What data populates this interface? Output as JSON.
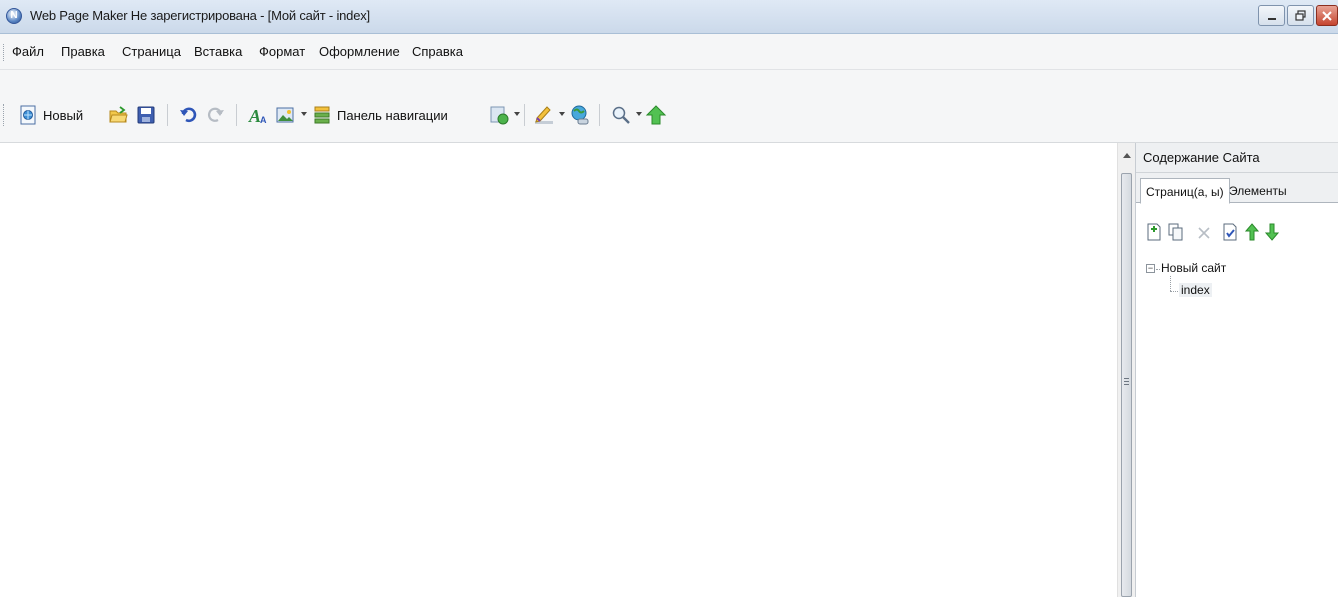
{
  "window": {
    "title": "Web Page Maker Не зарегистрирована - [Мой сайт - index]",
    "controls": [
      "minimize",
      "restore",
      "close"
    ]
  },
  "menu": {
    "items": [
      "Файл",
      "Правка",
      "Страница",
      "Вставка",
      "Формат",
      "Оформление",
      "Справка"
    ]
  },
  "toolbar": {
    "new_label": "Новый",
    "nav_panel_label": "Панель навигации",
    "icons": [
      "new-page-icon",
      "open-folder-icon",
      "save-icon",
      "undo-icon",
      "redo-icon",
      "text-style-icon",
      "image-icon",
      "navigation-panel-icon",
      "shape-icon",
      "draw-icon",
      "publish-icon",
      "zoom-icon",
      "upload-arrow-icon"
    ]
  },
  "panel": {
    "title": "Содержание Сайта",
    "tabs": [
      {
        "label": "Страниц(а, ы)",
        "active": true
      },
      {
        "label": "Элементы",
        "active": false
      }
    ],
    "tools": [
      "add-page-icon",
      "copy-page-icon",
      "delete-icon",
      "page-properties-icon",
      "move-up-icon",
      "move-down-icon"
    ],
    "tree": {
      "root": "Новый сайт",
      "children": [
        "index"
      ],
      "selected": "index"
    }
  },
  "colors": {
    "titlebar": "#cbd9ea",
    "close_button": "#c5452f",
    "arrow_green": "#2fae2f"
  }
}
